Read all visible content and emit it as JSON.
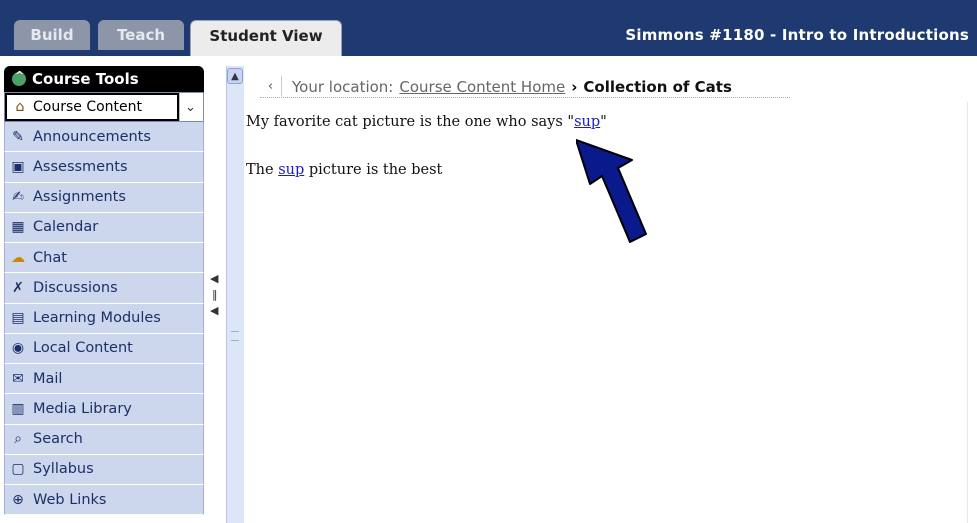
{
  "tabs": [
    {
      "label": "Build",
      "active": false
    },
    {
      "label": "Teach",
      "active": false
    },
    {
      "label": "Student View",
      "active": true
    }
  ],
  "course_title": "Simmons #1180 - Intro to Introductions",
  "sidebar": {
    "header": "Course Tools",
    "selected": "Course Content",
    "items": [
      {
        "label": "Announcements",
        "icon": "announcements-icon"
      },
      {
        "label": "Assessments",
        "icon": "assessments-icon"
      },
      {
        "label": "Assignments",
        "icon": "assignments-icon"
      },
      {
        "label": "Calendar",
        "icon": "calendar-icon"
      },
      {
        "label": "Chat",
        "icon": "chat-icon"
      },
      {
        "label": "Discussions",
        "icon": "discussions-icon"
      },
      {
        "label": "Learning Modules",
        "icon": "learning-modules-icon"
      },
      {
        "label": "Local Content",
        "icon": "local-content-icon"
      },
      {
        "label": "Mail",
        "icon": "mail-icon"
      },
      {
        "label": "Media Library",
        "icon": "media-library-icon"
      },
      {
        "label": "Search",
        "icon": "search-icon"
      },
      {
        "label": "Syllabus",
        "icon": "syllabus-icon"
      },
      {
        "label": "Web Links",
        "icon": "web-links-icon"
      }
    ]
  },
  "breadcrumb": {
    "prefix": "Your location:",
    "link": "Course Content Home",
    "separator": "›",
    "current": "Collection of Cats"
  },
  "content": {
    "para1_before": "My favorite cat picture is the one who says \"",
    "para1_link": "sup",
    "para1_after": "\"",
    "para2_before": "The ",
    "para2_link": "sup",
    "para2_after": " picture is the best"
  },
  "colors": {
    "topbar": "#1e3a70",
    "sidebar_item_bg": "#ccd6ec",
    "sidebar_text": "#1c2f68",
    "arrow": "#0a1a8c",
    "link": "#1a1acc"
  }
}
